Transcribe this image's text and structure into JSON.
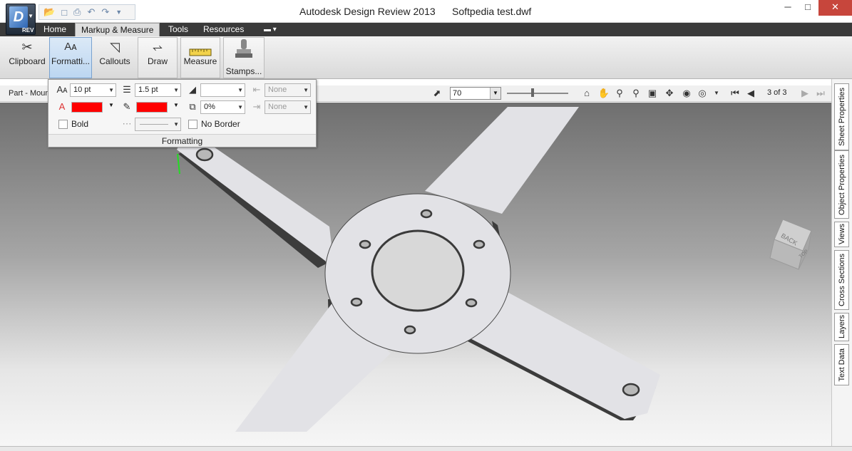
{
  "window": {
    "title": "Autodesk Design Review 2013",
    "document": "Softpedia test.dwf"
  },
  "app_button": {
    "letter": "D",
    "badge": "REV"
  },
  "menu": {
    "tabs": [
      "Home",
      "Markup & Measure",
      "Tools",
      "Resources"
    ]
  },
  "ribbon": {
    "buttons": [
      {
        "label": "Clipboard",
        "icon": "scissors-icon"
      },
      {
        "label": "Formatti...",
        "icon": "text-format-icon"
      },
      {
        "label": "Callouts",
        "icon": "callout-icon"
      },
      {
        "label": "Draw",
        "icon": "draw-line-icon"
      },
      {
        "label": "Measure",
        "icon": "ruler-icon"
      },
      {
        "label": "Stamps...",
        "icon": "stamp-icon"
      }
    ]
  },
  "formatting": {
    "font_size": "10 pt",
    "line_weight": "1.5 pt",
    "fill_opacity": "0%",
    "line_start": "None",
    "line_end": "None",
    "bold_label": "Bold",
    "no_border_label": "No Border",
    "panel_title": "Formatting",
    "text_color": "#ff0000",
    "line_color": "#ff0000"
  },
  "navbar": {
    "part_label": "Part - Mount",
    "zoom": "70",
    "page": "3 of 3"
  },
  "viewcube": {
    "back": "BACK",
    "top": "TOP"
  },
  "side_tabs": [
    "Sheet Properties",
    "Object Properties",
    "Views",
    "Cross Sections",
    "Layers",
    "Text Data"
  ]
}
